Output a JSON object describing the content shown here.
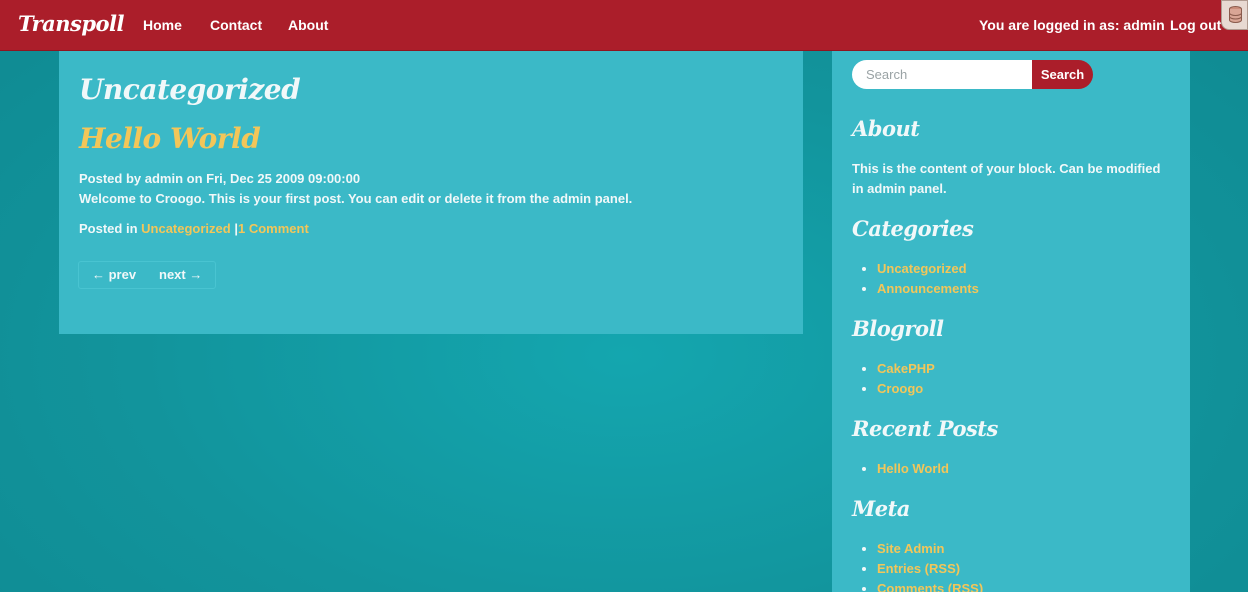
{
  "navbar": {
    "brand": "Transpoll",
    "links": [
      "Home",
      "Contact",
      "About"
    ],
    "logged_in_text": "You are logged in as: admin",
    "logout_label": "Log out",
    "colors": {
      "background": "#ab1e2a"
    }
  },
  "main": {
    "section_title": "Uncategorized",
    "post": {
      "title": "Hello World",
      "meta": "Posted by admin on Fri, Dec 25 2009 09:00:00",
      "body": "Welcome to Croogo. This is your first post. You can edit or delete it from the admin panel.",
      "footer_prefix": "Posted in",
      "category_link": "Uncategorized",
      "separator": "|",
      "comments_link": "1 Comment"
    },
    "pager": {
      "prev": "← prev",
      "next": "next →"
    }
  },
  "sidebar": {
    "search": {
      "placeholder": "Search",
      "button_label": "Search"
    },
    "about": {
      "title": "About",
      "text": "This is the content of your block. Can be modified in admin panel."
    },
    "categories": {
      "title": "Categories",
      "items": [
        "Uncategorized",
        "Announcements"
      ]
    },
    "blogroll": {
      "title": "Blogroll",
      "items": [
        "CakePHP",
        "Croogo"
      ]
    },
    "recent_posts": {
      "title": "Recent Posts",
      "items": [
        "Hello World"
      ]
    },
    "meta": {
      "title": "Meta",
      "items": [
        "Site Admin",
        "Entries (RSS)",
        "Comments (RSS)"
      ]
    }
  },
  "colors": {
    "page_background": "#12949c",
    "panel_background": "#3bb9c7",
    "link": "#f3c659",
    "accent": "#ab1e2a"
  }
}
